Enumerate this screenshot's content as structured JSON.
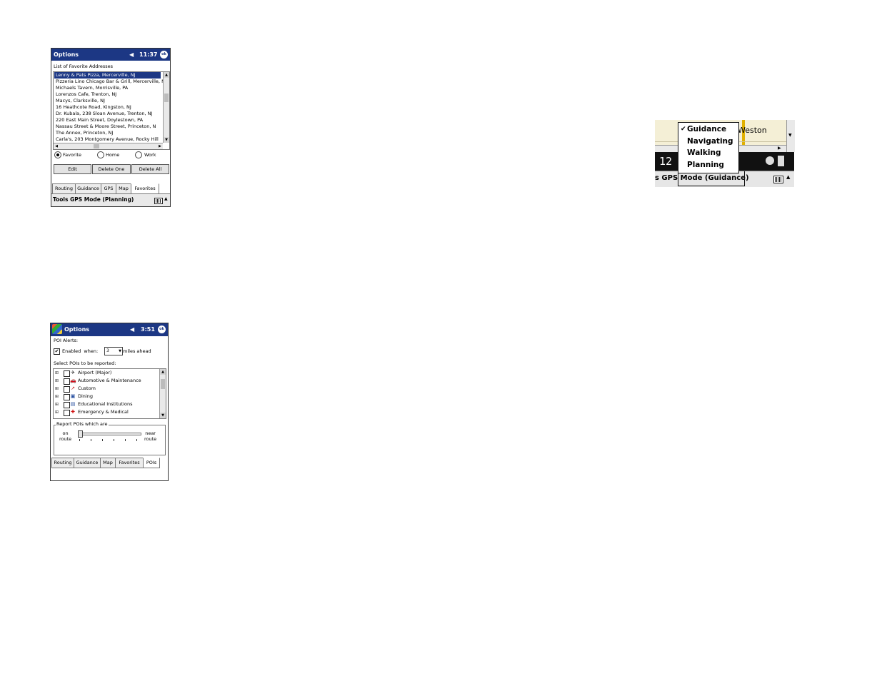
{
  "screen1": {
    "title": "Options",
    "time": "11:37",
    "ok": "ok",
    "list_label": "List of Favorite Addresses",
    "favorites": [
      "Lenny & Pats Pizza, Mercerville, NJ",
      "Pizzeria Lino Chicago Bar & Grill, Mercerville, N",
      "Michaels Tavern, Morrisville, PA",
      "Lorenzos Cafe, Trenton, NJ",
      "Macys, Clarksville, NJ",
      "16 Heathcote Road, Kingston, NJ",
      "Dr. Kubala, 238 Sloan Avenue, Trenton, NJ",
      "220 East Main Street, Doylestown, PA",
      "Nassau Street & Moore Street, Princeton, N",
      "The Annex, Princeton, NJ",
      "Carla's, 203 Montgomery Avenue, Rocky Hill"
    ],
    "radio_favorite": "Favorite",
    "radio_home": "Home",
    "radio_work": "Work",
    "btn_edit": "Edit",
    "btn_delete_one": "Delete One",
    "btn_delete_all": "Delete All",
    "tabs": [
      "Routing",
      "Guidance",
      "GPS",
      "Map",
      "Favorites"
    ],
    "menubar": "Tools GPS Mode (Planning)"
  },
  "screen2": {
    "title": "Options",
    "time": "3:51",
    "ok": "ok",
    "poi_alerts": "POI Alerts:",
    "enabled_when": "Enabled  when:",
    "miles_value": "3",
    "miles_ahead": "miles ahead",
    "select_label": "Select POIs to be reported:",
    "pois": [
      {
        "label": "Airport (Major)",
        "icon": "airplane-icon",
        "glyph": "✈",
        "color": "#222222"
      },
      {
        "label": "Automotive & Maintenance",
        "icon": "car-icon",
        "glyph": "🚗",
        "color": "#2850a0"
      },
      {
        "label": "Custom",
        "icon": "pin-icon",
        "glyph": "↗",
        "color": "#c02020"
      },
      {
        "label": "Dining",
        "icon": "dining-icon",
        "glyph": "▣",
        "color": "#2850a0"
      },
      {
        "label": "Educational Institutions",
        "icon": "school-icon",
        "glyph": "▤",
        "color": "#2850a0"
      },
      {
        "label": "Emergency & Medical",
        "icon": "medical-cross-icon",
        "glyph": "✚",
        "color": "#d01010"
      }
    ],
    "report_group": "Report POIs which are",
    "on_route": "on\nroute",
    "near_route": "near\nroute",
    "tabs": [
      "Routing",
      "Guidance",
      "Map",
      "Favorites",
      "POIs"
    ]
  },
  "snippet": {
    "map_text": "Weston",
    "speed_text": "12 a",
    "menubar": "s GPS Mode (Guidance)",
    "menu_items": [
      "Guidance",
      "Navigating",
      "Walking",
      "Planning"
    ],
    "checked": "Guidance"
  }
}
